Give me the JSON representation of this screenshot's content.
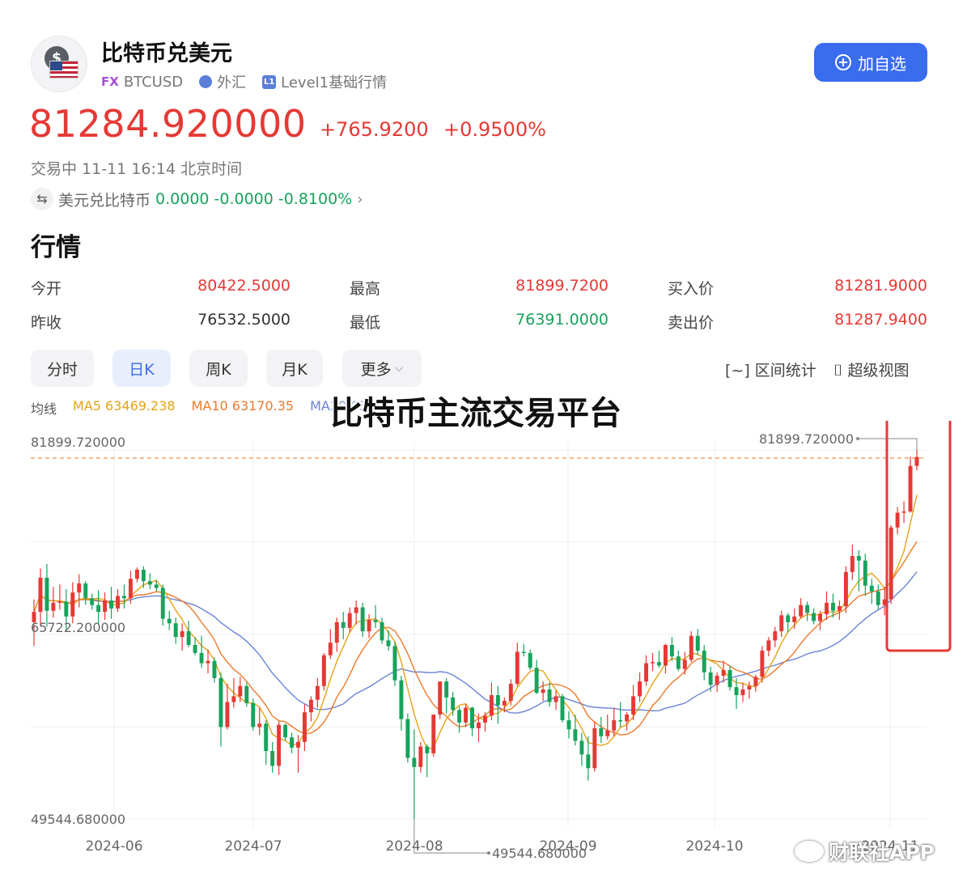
{
  "header": {
    "title": "比特币兑美元",
    "market_tag": "FX",
    "symbol": "BTCUSD",
    "category": "外汇",
    "level_badge": "L1",
    "level": "Level1基础行情",
    "add_button": "加自选"
  },
  "quote": {
    "price": "81284.920000",
    "change": "+765.9200",
    "change_pct": "+0.9500%",
    "status": "交易中 11-11 16:14 北京时间"
  },
  "reverse_pair": {
    "label": "美元兑比特币",
    "price": "0.0000",
    "change": "-0.0000",
    "change_pct": "-0.8100%"
  },
  "section": {
    "title": "行情"
  },
  "stats": {
    "open_label": "今开",
    "open": "80422.5000",
    "prev_close_label": "昨收",
    "prev_close": "76532.5000",
    "high_label": "最高",
    "high": "81899.7200",
    "low_label": "最低",
    "low": "76391.0000",
    "bid_label": "买入价",
    "bid": "81281.9000",
    "ask_label": "卖出价",
    "ask": "81287.9400"
  },
  "tabs": [
    "分时",
    "日K",
    "周K",
    "月K",
    "更多"
  ],
  "active_tab": "日K",
  "tools": {
    "range_stats": "区间统计",
    "super_view": "超级视图"
  },
  "ma": {
    "label": "均线",
    "ma5": "MA5 63469.238",
    "ma10": "MA10 63170.35",
    "ma20": "MA20 63"
  },
  "overlay_title": "比特币主流交易平台",
  "watermark": "财联社APP",
  "colors": {
    "up": "#e53935",
    "down": "#17a35c",
    "accent": "#3a6cf0",
    "ma5": "#e6a317",
    "ma10": "#ee7a2c",
    "ma20": "#6b83d6",
    "highlight_box": "#e53935"
  },
  "chart_data": {
    "type": "candlestick",
    "y_labels": [
      "81899.720000",
      "65722.200000",
      "49544.680000"
    ],
    "x_labels": [
      "2024-06",
      "2024-07",
      "2024-08",
      "2024-09",
      "2024-10",
      "2024-11"
    ],
    "ylim": [
      49544.68,
      81899.72
    ],
    "max_marker": "81899.720000",
    "min_marker": "49544.680000",
    "grid": true,
    "highlight": "latest candles (2024-11)",
    "candles": [
      {
        "o": 66800,
        "h": 68800,
        "l": 64700,
        "c": 67700
      },
      {
        "o": 67700,
        "h": 71500,
        "l": 66500,
        "c": 70700
      },
      {
        "o": 70700,
        "h": 71900,
        "l": 66400,
        "c": 67800
      },
      {
        "o": 67800,
        "h": 69900,
        "l": 67200,
        "c": 68500
      },
      {
        "o": 68500,
        "h": 70100,
        "l": 67900,
        "c": 68600
      },
      {
        "o": 68600,
        "h": 69700,
        "l": 66100,
        "c": 67300
      },
      {
        "o": 67300,
        "h": 70300,
        "l": 66700,
        "c": 69400
      },
      {
        "o": 69400,
        "h": 71000,
        "l": 68100,
        "c": 70200
      },
      {
        "o": 70200,
        "h": 70400,
        "l": 68300,
        "c": 68900
      },
      {
        "o": 68900,
        "h": 69300,
        "l": 67900,
        "c": 68300
      },
      {
        "o": 68300,
        "h": 69600,
        "l": 66700,
        "c": 67700
      },
      {
        "o": 67700,
        "h": 69400,
        "l": 67000,
        "c": 68700
      },
      {
        "o": 68700,
        "h": 69900,
        "l": 67100,
        "c": 68000
      },
      {
        "o": 68000,
        "h": 69700,
        "l": 67700,
        "c": 69100
      },
      {
        "o": 69100,
        "h": 70100,
        "l": 68000,
        "c": 68900
      },
      {
        "o": 68900,
        "h": 71300,
        "l": 68400,
        "c": 70600
      },
      {
        "o": 70600,
        "h": 71600,
        "l": 70300,
        "c": 71400
      },
      {
        "o": 71400,
        "h": 71700,
        "l": 69800,
        "c": 70400
      },
      {
        "o": 70400,
        "h": 71100,
        "l": 69700,
        "c": 70100
      },
      {
        "o": 70100,
        "h": 70500,
        "l": 69500,
        "c": 69800
      },
      {
        "o": 69800,
        "h": 70100,
        "l": 66500,
        "c": 67100
      },
      {
        "o": 67100,
        "h": 67800,
        "l": 66100,
        "c": 66700
      },
      {
        "o": 66700,
        "h": 67200,
        "l": 64900,
        "c": 65500
      },
      {
        "o": 65500,
        "h": 66700,
        "l": 64300,
        "c": 66000
      },
      {
        "o": 66000,
        "h": 66900,
        "l": 64600,
        "c": 64800
      },
      {
        "o": 64800,
        "h": 65500,
        "l": 63900,
        "c": 64100
      },
      {
        "o": 64100,
        "h": 65600,
        "l": 62800,
        "c": 63200
      },
      {
        "o": 63200,
        "h": 64400,
        "l": 62300,
        "c": 63400
      },
      {
        "o": 63400,
        "h": 63700,
        "l": 61500,
        "c": 61900
      },
      {
        "o": 61900,
        "h": 62400,
        "l": 55900,
        "c": 57600
      },
      {
        "o": 57600,
        "h": 61400,
        "l": 57400,
        "c": 59800
      },
      {
        "o": 59800,
        "h": 61900,
        "l": 59300,
        "c": 60300
      },
      {
        "o": 60300,
        "h": 62000,
        "l": 59800,
        "c": 61200
      },
      {
        "o": 61200,
        "h": 61500,
        "l": 59400,
        "c": 59700
      },
      {
        "o": 59700,
        "h": 60100,
        "l": 57300,
        "c": 57600
      },
      {
        "o": 57600,
        "h": 59300,
        "l": 56900,
        "c": 57900
      },
      {
        "o": 57900,
        "h": 58200,
        "l": 54300,
        "c": 55500
      },
      {
        "o": 55500,
        "h": 56300,
        "l": 53600,
        "c": 54200
      },
      {
        "o": 54200,
        "h": 58100,
        "l": 53400,
        "c": 57800
      },
      {
        "o": 57800,
        "h": 57900,
        "l": 56400,
        "c": 56700
      },
      {
        "o": 56700,
        "h": 57100,
        "l": 55300,
        "c": 55800
      },
      {
        "o": 55800,
        "h": 56900,
        "l": 53600,
        "c": 56300
      },
      {
        "o": 56300,
        "h": 59600,
        "l": 55500,
        "c": 58900
      },
      {
        "o": 58900,
        "h": 60300,
        "l": 58100,
        "c": 60000
      },
      {
        "o": 60000,
        "h": 61900,
        "l": 59300,
        "c": 61200
      },
      {
        "o": 61200,
        "h": 64100,
        "l": 60800,
        "c": 63900
      },
      {
        "o": 63900,
        "h": 66200,
        "l": 63600,
        "c": 65000
      },
      {
        "o": 65000,
        "h": 67200,
        "l": 64200,
        "c": 66800
      },
      {
        "o": 66800,
        "h": 67700,
        "l": 65300,
        "c": 66300
      },
      {
        "o": 66300,
        "h": 68100,
        "l": 65900,
        "c": 67600
      },
      {
        "o": 67600,
        "h": 68700,
        "l": 66600,
        "c": 68100
      },
      {
        "o": 68100,
        "h": 68500,
        "l": 65500,
        "c": 66000
      },
      {
        "o": 66000,
        "h": 67500,
        "l": 65400,
        "c": 67000
      },
      {
        "o": 67000,
        "h": 68300,
        "l": 66300,
        "c": 66800
      },
      {
        "o": 66800,
        "h": 67200,
        "l": 64900,
        "c": 65200
      },
      {
        "o": 65200,
        "h": 66100,
        "l": 64300,
        "c": 64700
      },
      {
        "o": 64700,
        "h": 65100,
        "l": 61200,
        "c": 61700
      },
      {
        "o": 61700,
        "h": 62100,
        "l": 57300,
        "c": 58300
      },
      {
        "o": 58300,
        "h": 58800,
        "l": 54500,
        "c": 54900
      },
      {
        "o": 54900,
        "h": 57400,
        "l": 49545,
        "c": 54100
      },
      {
        "o": 54100,
        "h": 56300,
        "l": 53600,
        "c": 55900
      },
      {
        "o": 55900,
        "h": 56100,
        "l": 53200,
        "c": 55300
      },
      {
        "o": 55300,
        "h": 57100,
        "l": 55000,
        "c": 58700
      },
      {
        "o": 58700,
        "h": 61300,
        "l": 58300,
        "c": 61600
      },
      {
        "o": 61600,
        "h": 61900,
        "l": 58800,
        "c": 60200
      },
      {
        "o": 60200,
        "h": 60700,
        "l": 58600,
        "c": 59100
      },
      {
        "o": 59100,
        "h": 59400,
        "l": 57100,
        "c": 58000
      },
      {
        "o": 58000,
        "h": 59600,
        "l": 57600,
        "c": 59300
      },
      {
        "o": 59300,
        "h": 59400,
        "l": 56800,
        "c": 57500
      },
      {
        "o": 57500,
        "h": 58800,
        "l": 56300,
        "c": 58000
      },
      {
        "o": 58000,
        "h": 58900,
        "l": 57200,
        "c": 58600
      },
      {
        "o": 58600,
        "h": 61500,
        "l": 58200,
        "c": 60400
      },
      {
        "o": 60400,
        "h": 61200,
        "l": 57900,
        "c": 59500
      },
      {
        "o": 59500,
        "h": 60200,
        "l": 58900,
        "c": 59900
      },
      {
        "o": 59900,
        "h": 61800,
        "l": 59500,
        "c": 61400
      },
      {
        "o": 61400,
        "h": 65000,
        "l": 61200,
        "c": 64200
      },
      {
        "o": 64200,
        "h": 64900,
        "l": 63800,
        "c": 64100
      },
      {
        "o": 64100,
        "h": 64400,
        "l": 62600,
        "c": 62800
      },
      {
        "o": 62800,
        "h": 63500,
        "l": 60500,
        "c": 60600
      },
      {
        "o": 60600,
        "h": 61600,
        "l": 59900,
        "c": 60900
      },
      {
        "o": 60900,
        "h": 61500,
        "l": 59400,
        "c": 59800
      },
      {
        "o": 59800,
        "h": 60800,
        "l": 59100,
        "c": 60300
      },
      {
        "o": 60300,
        "h": 60500,
        "l": 58000,
        "c": 58200
      },
      {
        "o": 58200,
        "h": 59000,
        "l": 56600,
        "c": 57400
      },
      {
        "o": 57400,
        "h": 58700,
        "l": 56000,
        "c": 56400
      },
      {
        "o": 56400,
        "h": 57100,
        "l": 54200,
        "c": 55200
      },
      {
        "o": 55200,
        "h": 56800,
        "l": 52900,
        "c": 54000
      },
      {
        "o": 54000,
        "h": 58100,
        "l": 53700,
        "c": 57500
      },
      {
        "o": 57500,
        "h": 58500,
        "l": 56200,
        "c": 56800
      },
      {
        "o": 56800,
        "h": 58700,
        "l": 56500,
        "c": 57300
      },
      {
        "o": 57300,
        "h": 59300,
        "l": 56800,
        "c": 58200
      },
      {
        "o": 58200,
        "h": 59800,
        "l": 57600,
        "c": 58100
      },
      {
        "o": 58100,
        "h": 58900,
        "l": 57300,
        "c": 58700
      },
      {
        "o": 58700,
        "h": 61300,
        "l": 58200,
        "c": 60300
      },
      {
        "o": 60300,
        "h": 62400,
        "l": 59800,
        "c": 61600
      },
      {
        "o": 61600,
        "h": 63900,
        "l": 61200,
        "c": 63200
      },
      {
        "o": 63200,
        "h": 64100,
        "l": 62500,
        "c": 63300
      },
      {
        "o": 63300,
        "h": 64300,
        "l": 62800,
        "c": 63000
      },
      {
        "o": 63000,
        "h": 64900,
        "l": 62300,
        "c": 64800
      },
      {
        "o": 64800,
        "h": 65500,
        "l": 63400,
        "c": 63800
      },
      {
        "o": 63800,
        "h": 64300,
        "l": 62500,
        "c": 62700
      },
      {
        "o": 62700,
        "h": 64200,
        "l": 62200,
        "c": 63500
      },
      {
        "o": 63500,
        "h": 66000,
        "l": 63300,
        "c": 65600
      },
      {
        "o": 65600,
        "h": 66200,
        "l": 63900,
        "c": 64300
      },
      {
        "o": 64300,
        "h": 64800,
        "l": 61700,
        "c": 62400
      },
      {
        "o": 62400,
        "h": 62900,
        "l": 60700,
        "c": 61300
      },
      {
        "o": 61300,
        "h": 62400,
        "l": 60700,
        "c": 62100
      },
      {
        "o": 62100,
        "h": 63400,
        "l": 61500,
        "c": 62600
      },
      {
        "o": 62600,
        "h": 63000,
        "l": 60800,
        "c": 61100
      },
      {
        "o": 61100,
        "h": 61900,
        "l": 59200,
        "c": 60400
      },
      {
        "o": 60400,
        "h": 61500,
        "l": 59800,
        "c": 60900
      },
      {
        "o": 60900,
        "h": 61600,
        "l": 60100,
        "c": 61200
      },
      {
        "o": 61200,
        "h": 62200,
        "l": 60700,
        "c": 62000
      },
      {
        "o": 62000,
        "h": 64700,
        "l": 61500,
        "c": 64300
      },
      {
        "o": 64300,
        "h": 65500,
        "l": 63800,
        "c": 65200
      },
      {
        "o": 65200,
        "h": 66400,
        "l": 64600,
        "c": 66000
      },
      {
        "o": 66000,
        "h": 67800,
        "l": 65500,
        "c": 67400
      },
      {
        "o": 67400,
        "h": 67600,
        "l": 65900,
        "c": 66800
      },
      {
        "o": 66800,
        "h": 68000,
        "l": 66200,
        "c": 67300
      },
      {
        "o": 67300,
        "h": 68900,
        "l": 67100,
        "c": 68300
      },
      {
        "o": 68300,
        "h": 68600,
        "l": 66900,
        "c": 67600
      },
      {
        "o": 67600,
        "h": 68000,
        "l": 66600,
        "c": 66900
      },
      {
        "o": 66900,
        "h": 67800,
        "l": 66100,
        "c": 67500
      },
      {
        "o": 67500,
        "h": 69500,
        "l": 67000,
        "c": 68500
      },
      {
        "o": 68500,
        "h": 69300,
        "l": 67200,
        "c": 67800
      },
      {
        "o": 67800,
        "h": 68700,
        "l": 67000,
        "c": 68200
      },
      {
        "o": 68200,
        "h": 71700,
        "l": 67600,
        "c": 71200
      },
      {
        "o": 71200,
        "h": 73600,
        "l": 70500,
        "c": 72600
      },
      {
        "o": 72600,
        "h": 73100,
        "l": 69500,
        "c": 72200
      },
      {
        "o": 72200,
        "h": 72800,
        "l": 69100,
        "c": 70000
      },
      {
        "o": 70000,
        "h": 70600,
        "l": 68400,
        "c": 69500
      },
      {
        "o": 69500,
        "h": 70100,
        "l": 67900,
        "c": 68300
      },
      {
        "o": 68300,
        "h": 69900,
        "l": 67400,
        "c": 68800
      },
      {
        "o": 68800,
        "h": 75300,
        "l": 68400,
        "c": 75100
      },
      {
        "o": 75100,
        "h": 76900,
        "l": 74500,
        "c": 76400
      },
      {
        "o": 76400,
        "h": 77400,
        "l": 75500,
        "c": 76500
      },
      {
        "o": 76500,
        "h": 81300,
        "l": 76400,
        "c": 80500
      },
      {
        "o": 80500,
        "h": 81900,
        "l": 80100,
        "c": 81285
      }
    ]
  }
}
